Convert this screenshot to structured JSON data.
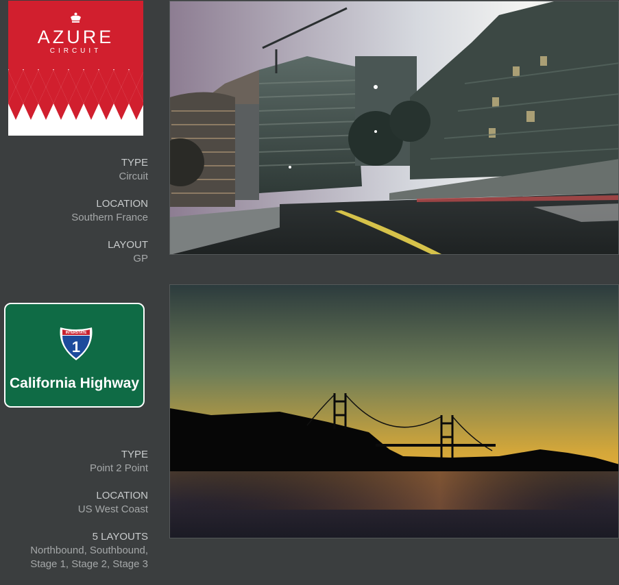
{
  "tracks": [
    {
      "logo": {
        "title": "AZURE",
        "subtitle": "CIRCUIT",
        "icon": "crown-icon",
        "colors": {
          "primary": "#d11f2e",
          "secondary": "#ffffff"
        }
      },
      "info": [
        {
          "label": "TYPE",
          "value": "Circuit"
        },
        {
          "label": "LOCATION",
          "value": "Southern France"
        },
        {
          "label": "LAYOUT",
          "value": "GP"
        }
      ]
    },
    {
      "logo": {
        "shield_top": "INTERSTATE",
        "shield_number": "1",
        "title": "California Highway",
        "icon": "interstate-shield-icon",
        "colors": {
          "primary": "#0f6b45",
          "shield": "#1d4a9c",
          "shield_band": "#c8202f"
        }
      },
      "info": [
        {
          "label": "TYPE",
          "value": "Point 2 Point"
        },
        {
          "label": "LOCATION",
          "value": "US West Coast"
        },
        {
          "label": "5 LAYOUTS",
          "value": "Northbound, Southbound,",
          "value2": "Stage 1, Stage 2, Stage 3"
        }
      ]
    }
  ]
}
